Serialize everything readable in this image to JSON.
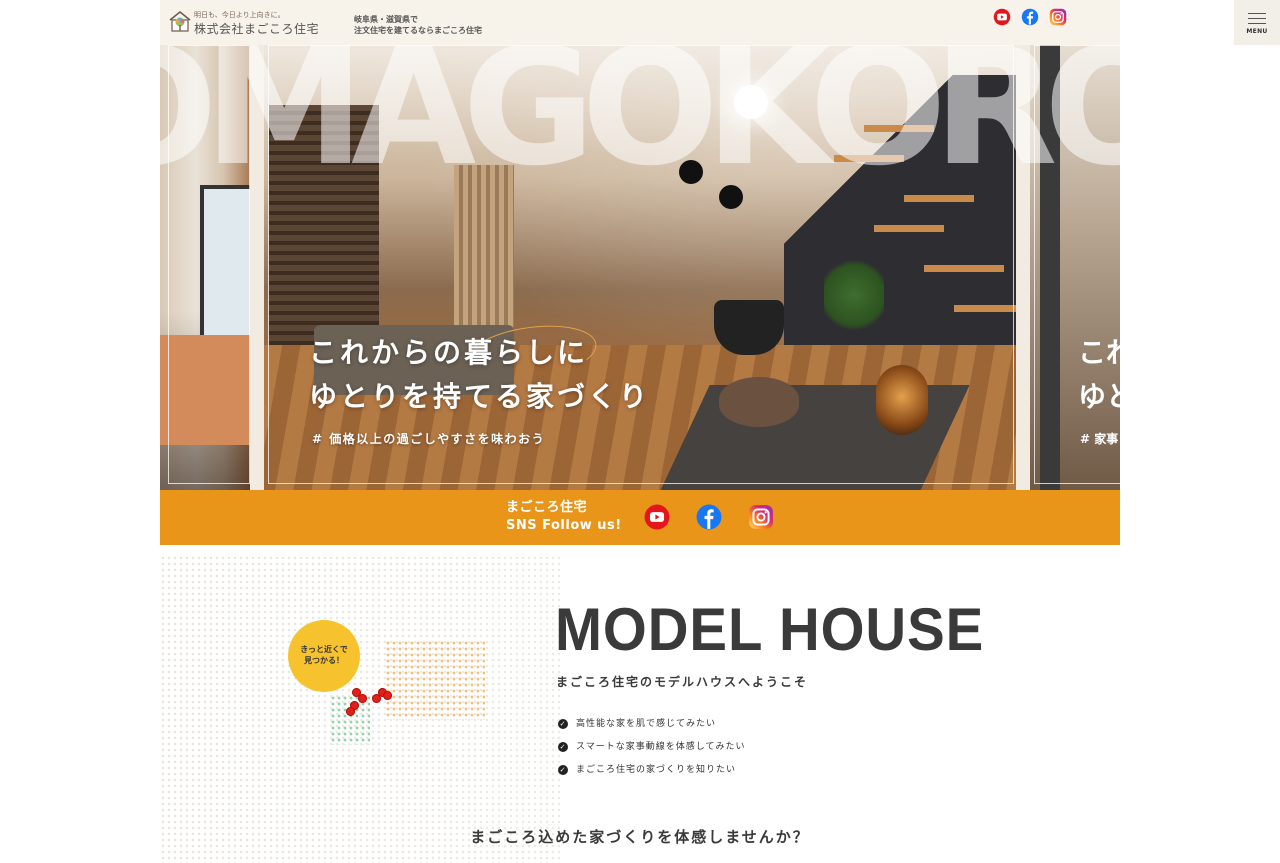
{
  "header": {
    "logo_tagline": "明日も、今日より上向きに。",
    "logo_name": "株式会社まごころ住宅",
    "desc_line1": "岐阜県・滋賀県で",
    "desc_line2": "注文住宅を建てるならまごころ住宅",
    "sns_icons": [
      "youtube-icon",
      "facebook-icon",
      "instagram-icon"
    ]
  },
  "menu": {
    "label": "MENU"
  },
  "hero": {
    "watermark": "OMAGOKOROMA",
    "copy_line1": "これからの暮らしに",
    "copy_line2": "ゆとりを持てる家づくり",
    "sub": "# 価格以上の過ごしやすさを味わおう",
    "next_copy_line1": "これ",
    "next_copy_line2": "ゆと",
    "next_sub": "# 家事"
  },
  "sns_bar": {
    "line1": "まごころ住宅",
    "line2": "SNS Follow us!",
    "icons": [
      "youtube-icon",
      "facebook-icon",
      "instagram-icon"
    ],
    "background": "#e89519"
  },
  "model_house": {
    "badge_line1": "きっと近くで",
    "badge_line2": "見つかる！",
    "title": "MODEL HOUSE",
    "subtitle": "まごころ住宅のモデルハウスへようこそ",
    "checklist": [
      "高性能な家を肌で感じてみたい",
      "スマートな家事動線を体感してみたい",
      "まごころ住宅の家づくりを知りたい"
    ],
    "cta": "まごころ込めた家づくりを体感しませんか？"
  },
  "colors": {
    "accent_orange": "#e89519",
    "badge_yellow": "#f6c32f",
    "pin_red": "#e0201b",
    "header_bg": "#f7f2ea"
  }
}
